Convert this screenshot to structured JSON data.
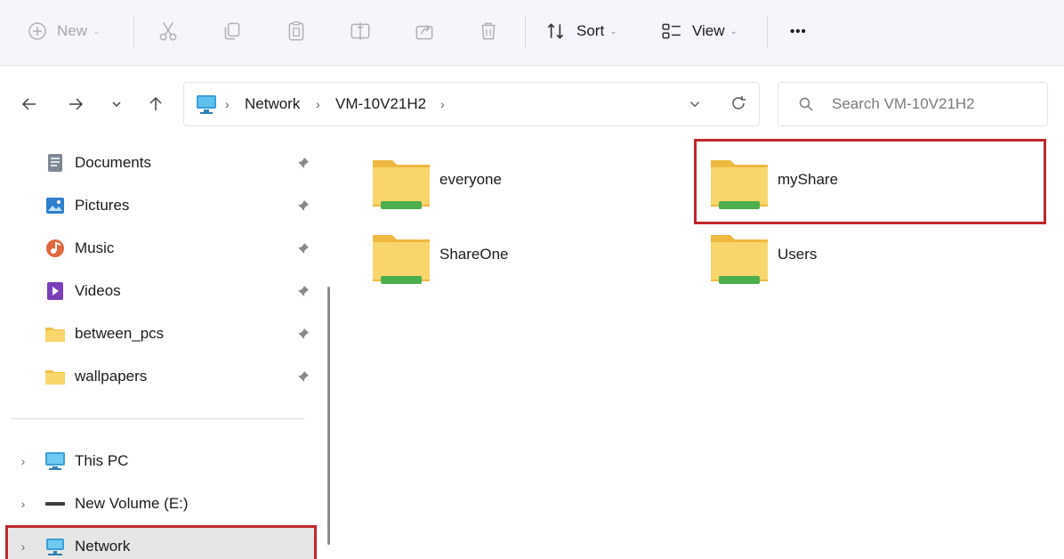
{
  "toolbar": {
    "new_label": "New",
    "sort_label": "Sort",
    "view_label": "View",
    "more_label": "•••"
  },
  "address": {
    "crumbs": [
      "Network",
      "VM-10V21H2"
    ],
    "search_placeholder": "Search VM-10V21H2"
  },
  "sidebar": {
    "quick_access": [
      {
        "label": "Documents",
        "icon": "documents-icon"
      },
      {
        "label": "Pictures",
        "icon": "pictures-icon"
      },
      {
        "label": "Music",
        "icon": "music-icon"
      },
      {
        "label": "Videos",
        "icon": "videos-icon"
      },
      {
        "label": "between_pcs",
        "icon": "folder-icon"
      },
      {
        "label": "wallpapers",
        "icon": "folder-icon"
      }
    ],
    "drives": [
      {
        "label": "This PC",
        "icon": "pc-icon"
      },
      {
        "label": "New Volume (E:)",
        "icon": "drive-icon"
      },
      {
        "label": "Network",
        "icon": "network-icon",
        "selected": true
      }
    ]
  },
  "content": {
    "folders": [
      "everyone",
      "myShare",
      "ShareOne",
      "Users"
    ],
    "highlighted": "myShare"
  },
  "colors": {
    "highlight": "#c0272d",
    "folder_yellow": "#f7d35e",
    "share_green": "#4cae4c",
    "toolbar_bg": "#f7f4fb"
  }
}
